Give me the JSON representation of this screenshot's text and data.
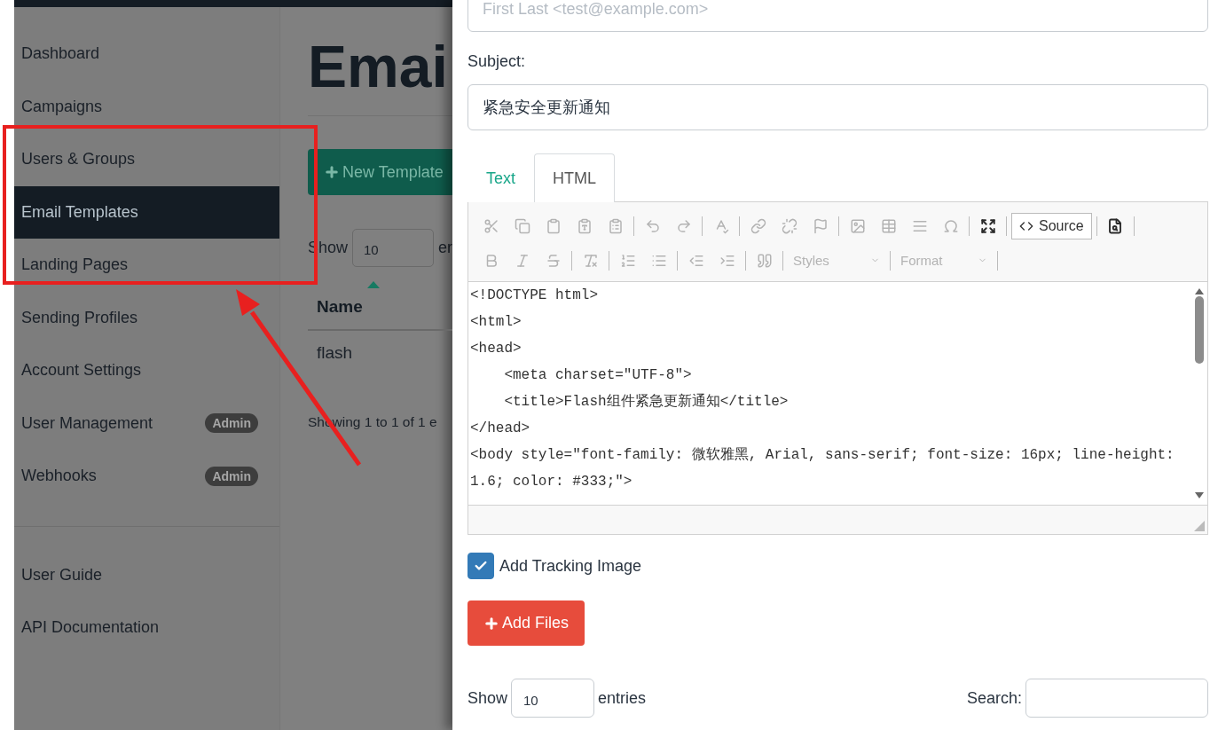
{
  "background_page": {
    "sidebar": {
      "items": [
        {
          "label": "Dashboard",
          "selected": false
        },
        {
          "label": "Campaigns",
          "selected": false
        },
        {
          "label": "Users & Groups",
          "selected": false
        },
        {
          "label": "Email Templates",
          "selected": true
        },
        {
          "label": "Landing Pages",
          "selected": false
        },
        {
          "label": "Sending Profiles",
          "selected": false
        },
        {
          "label": "Account Settings",
          "selected": false
        },
        {
          "label": "User Management",
          "selected": false,
          "badge": "Admin"
        },
        {
          "label": "Webhooks",
          "selected": false,
          "badge": "Admin"
        }
      ],
      "footer_items": [
        {
          "label": "User Guide"
        },
        {
          "label": "API Documentation"
        }
      ]
    },
    "title": "Emai",
    "new_button": "New Template",
    "show_label": "Show",
    "show_value": "10",
    "entries_label": "er",
    "table": {
      "columns": [
        {
          "label": "Name",
          "sorted": true
        }
      ],
      "rows": [
        [
          "flash"
        ]
      ]
    },
    "info": "Showing 1 to 1 of 1 e"
  },
  "modal": {
    "from": {
      "placeholder": "First Last <test@example.com>"
    },
    "subject": {
      "label": "Subject:",
      "value": "紧急安全更新通知"
    },
    "tabs": [
      {
        "label": "Text",
        "selected": false
      },
      {
        "label": "HTML",
        "selected": true
      }
    ],
    "toolbar": [
      [
        {
          "kind": "button",
          "disabled": true
        },
        {
          "kind": "button",
          "disabled": true
        },
        {
          "kind": "button",
          "disabled": true
        },
        {
          "kind": "button",
          "disabled": true
        },
        {
          "kind": "button",
          "disabled": true
        },
        {
          "kind": "separator"
        },
        {
          "kind": "button",
          "disabled": true
        },
        {
          "kind": "button",
          "disabled": true
        },
        {
          "kind": "separator"
        },
        {
          "kind": "button",
          "disabled": true
        },
        {
          "kind": "separator"
        },
        {
          "kind": "button",
          "disabled": true
        },
        {
          "kind": "button",
          "disabled": true
        },
        {
          "kind": "button",
          "disabled": true
        },
        {
          "kind": "separator"
        },
        {
          "kind": "button",
          "disabled": true
        },
        {
          "kind": "button",
          "disabled": true
        },
        {
          "kind": "button",
          "disabled": true
        },
        {
          "kind": "button",
          "disabled": true
        },
        {
          "kind": "separator"
        },
        {
          "kind": "button",
          "disabled": false
        },
        {
          "kind": "separator"
        },
        {
          "kind": "toggle",
          "label": "Source",
          "selected": true
        },
        {
          "kind": "separator"
        },
        {
          "kind": "button",
          "disabled": false
        },
        {
          "kind": "separator"
        }
      ],
      [
        {
          "kind": "button",
          "disabled": true
        },
        {
          "kind": "button",
          "disabled": true
        },
        {
          "kind": "button",
          "disabled": true
        },
        {
          "kind": "separator"
        },
        {
          "kind": "button",
          "disabled": true
        },
        {
          "kind": "separator"
        },
        {
          "kind": "button",
          "disabled": true
        },
        {
          "kind": "button",
          "disabled": true
        },
        {
          "kind": "separator"
        },
        {
          "kind": "button",
          "disabled": true
        },
        {
          "kind": "button",
          "disabled": true
        },
        {
          "kind": "separator"
        },
        {
          "kind": "button",
          "disabled": true
        },
        {
          "kind": "separator"
        },
        {
          "kind": "dropdown",
          "label": "Styles",
          "disabled": true
        },
        {
          "kind": "separator"
        },
        {
          "kind": "dropdown",
          "label": "Format",
          "disabled": true
        },
        {
          "kind": "separator"
        }
      ]
    ],
    "code_lines": [
      "<!DOCTYPE html>",
      "<html>",
      "<head>",
      "    <meta charset=\"UTF-8\">",
      "    <title>Flash组件紧急更新通知</title>",
      "</head>",
      "<body style=\"font-family: 微软雅黑, Arial, sans-serif; font-size: 16px; line-height: 1.6; color: #333;\">"
    ],
    "tracking": {
      "label": "Add Tracking Image",
      "checked": true
    },
    "add_files": "Add Files",
    "show_label": "Show",
    "show_value": "10",
    "entries_label": "entries",
    "search_label": "Search:"
  },
  "annotation_box": {
    "color": "#e8201f"
  },
  "annotation_arrow": {
    "color": "#e8201f"
  }
}
